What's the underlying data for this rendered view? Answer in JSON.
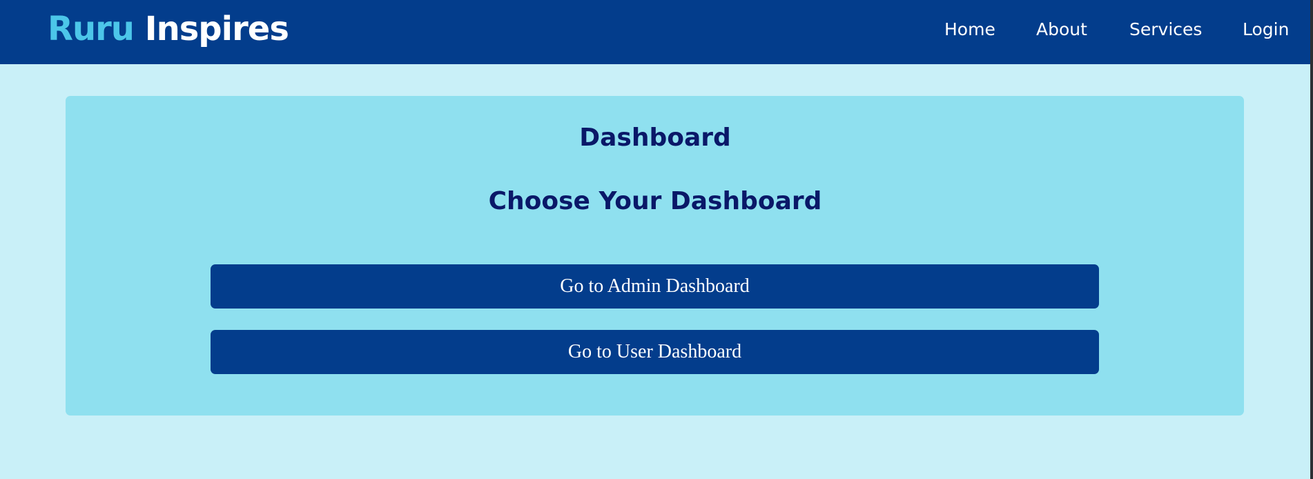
{
  "brand": {
    "part1": "Ruru",
    "part2": "Inspires"
  },
  "nav": {
    "home": "Home",
    "about": "About",
    "services": "Services",
    "login": "Login"
  },
  "dashboard": {
    "title": "Dashboard",
    "subtitle": "Choose Your Dashboard",
    "admin_button": "Go to Admin Dashboard",
    "user_button": "Go to User Dashboard"
  },
  "colors": {
    "navbar": "#033d8c",
    "brand_accent": "#4cc6e9",
    "page_background": "#c9f0f8",
    "card_background": "#8fe0ef",
    "heading_text": "#0a1868",
    "button_background": "#033d8c"
  }
}
